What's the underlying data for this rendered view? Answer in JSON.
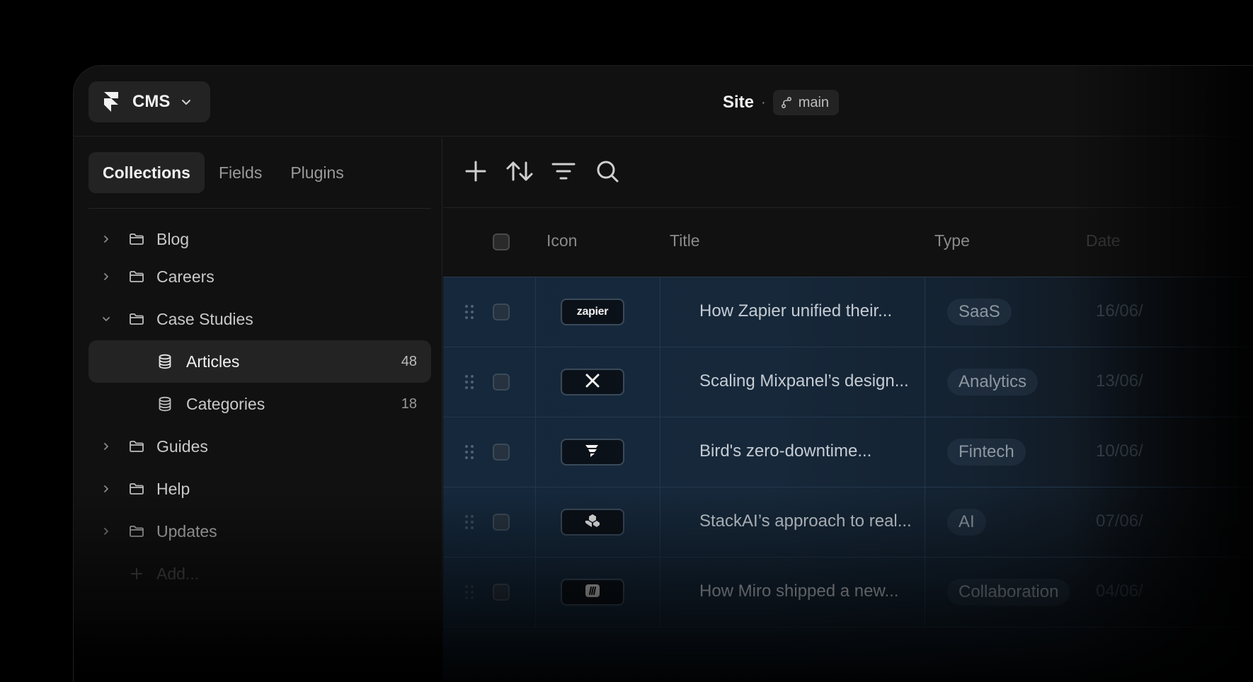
{
  "header": {
    "app_name": "CMS",
    "site_name": "Site",
    "separator": "·",
    "branch": "main"
  },
  "sidebar": {
    "tabs": [
      {
        "label": "Collections",
        "active": true
      },
      {
        "label": "Fields",
        "active": false
      },
      {
        "label": "Plugins",
        "active": false
      }
    ],
    "tree": [
      {
        "label": "Blog",
        "type": "folder",
        "expanded": false
      },
      {
        "label": "Careers",
        "type": "folder",
        "expanded": false
      },
      {
        "label": "Case Studies",
        "type": "folder",
        "expanded": true
      },
      {
        "label": "Articles",
        "type": "collection",
        "count": "48",
        "selected": true
      },
      {
        "label": "Categories",
        "type": "collection",
        "count": "18"
      },
      {
        "label": "Guides",
        "type": "folder",
        "expanded": false
      },
      {
        "label": "Help",
        "type": "folder",
        "expanded": false
      },
      {
        "label": "Updates",
        "type": "folder",
        "expanded": false
      }
    ],
    "add_label": "Add..."
  },
  "toolbar": {
    "icons": [
      "plus-icon",
      "sort-icon",
      "filter-icon",
      "search-icon"
    ]
  },
  "table": {
    "columns": [
      "Icon",
      "Title",
      "Type",
      "Date"
    ],
    "rows": [
      {
        "logo": "zapier",
        "title": "How Zapier unified their...",
        "type": "SaaS",
        "date": "16/06/"
      },
      {
        "logo": "mixpanel",
        "title": "Scaling Mixpanel’s design...",
        "type": "Analytics",
        "date": "13/06/"
      },
      {
        "logo": "bird",
        "title": "Bird's zero-downtime...",
        "type": "Fintech",
        "date": "10/06/"
      },
      {
        "logo": "stackai",
        "title": "StackAI’s approach to real...",
        "type": "AI",
        "date": "07/06/"
      },
      {
        "logo": "miro",
        "title": "How Miro shipped a new...",
        "type": "Collaboration",
        "date": "04/06/"
      }
    ]
  },
  "colors": {
    "window_bg": "#111111",
    "panel": "#232323",
    "row_bg": "#15283c"
  }
}
